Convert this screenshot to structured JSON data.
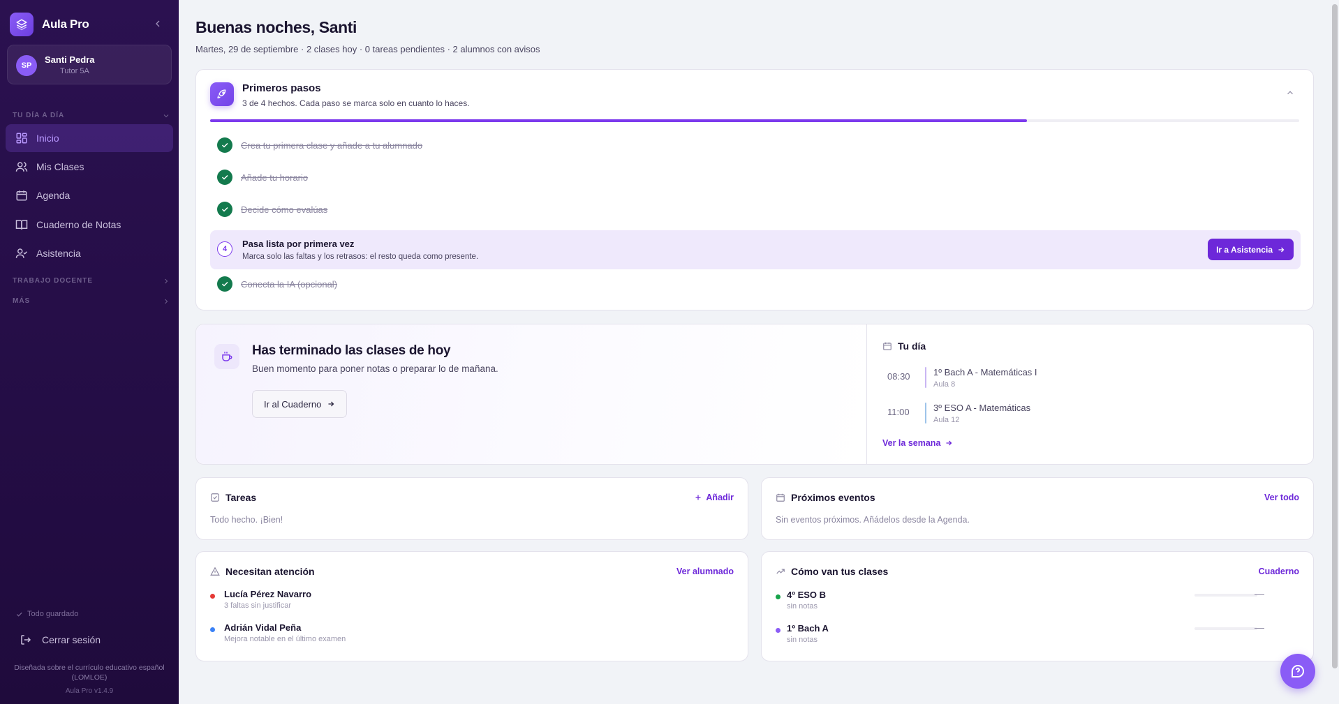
{
  "app": {
    "name": "Aula Pro",
    "version": "Aula Pro v1.4.9"
  },
  "user": {
    "initials": "SP",
    "name": "Santi Pedra",
    "role": "Tutor 5A"
  },
  "sidebar": {
    "sections": {
      "daily": "TU DÍA A DÍA",
      "work": "TRABAJO DOCENTE",
      "more": "MÁS"
    },
    "items": [
      {
        "label": "Inicio",
        "icon": "dashboard-icon",
        "active": true
      },
      {
        "label": "Mis Clases",
        "icon": "users-icon"
      },
      {
        "label": "Agenda",
        "icon": "calendar-icon"
      },
      {
        "label": "Cuaderno de Notas",
        "icon": "book-icon"
      },
      {
        "label": "Asistencia",
        "icon": "user-check-icon"
      }
    ],
    "saved": "Todo guardado",
    "logout": "Cerrar sesión",
    "footer_note": "Diseñada sobre el currículo educativo español (LOMLOE)"
  },
  "header": {
    "greeting": "Buenas noches, Santi",
    "summary": "Martes, 29 de septiembre · 2 clases hoy · 0 tareas pendientes · 2 alumnos con avisos"
  },
  "onboarding": {
    "title": "Primeros pasos",
    "subtitle": "3 de 4 hechos. Cada paso se marca solo en cuanto lo haces.",
    "progress": 0.75,
    "steps": [
      {
        "label": "Crea tu primera clase y añade a tu alumnado",
        "done": true
      },
      {
        "label": "Añade tu horario",
        "done": true
      },
      {
        "label": "Decide cómo evalúas",
        "done": true
      },
      {
        "number": "4",
        "label": "Pasa lista por primera vez",
        "description": "Marca solo las faltas y los retrasos: el resto queda como presente.",
        "done": false,
        "action": "Ir a Asistencia"
      },
      {
        "label": "Conecta la IA (opcional)",
        "done": true
      }
    ]
  },
  "today": {
    "title": "Has terminado las clases de hoy",
    "subtitle": "Buen momento para poner notas o preparar lo de mañana.",
    "action": "Ir al Cuaderno",
    "day_title": "Tu día",
    "schedule": [
      {
        "time": "08:30",
        "subject": "1º Bach A - Matemáticas I",
        "room": "Aula 8",
        "color": "#c9b6f3"
      },
      {
        "time": "11:00",
        "subject": "3º ESO A - Matemáticas",
        "room": "Aula 12",
        "color": "#9ec4ea"
      }
    ],
    "week_link": "Ver la semana"
  },
  "tasks": {
    "title": "Tareas",
    "add": "Añadir",
    "empty": "Todo hecho. ¡Bien!"
  },
  "events": {
    "title": "Próximos eventos",
    "link": "Ver todo",
    "empty": "Sin eventos próximos. Añádelos desde la Agenda."
  },
  "attention": {
    "title": "Necesitan atención",
    "link": "Ver alumnado",
    "students": [
      {
        "name": "Lucía Pérez Navarro",
        "note": "3 faltas sin justificar",
        "color": "#e53935"
      },
      {
        "name": "Adrián Vidal Peña",
        "note": "Mejora notable en el último examen",
        "color": "#3b82f6"
      }
    ]
  },
  "classes": {
    "title": "Cómo van tus clases",
    "link": "Cuaderno",
    "items": [
      {
        "name": "4º ESO B",
        "note": "sin notas",
        "value": "—",
        "color": "#16a34a"
      },
      {
        "name": "1º Bach A",
        "note": "sin notas",
        "value": "—",
        "color": "#8b5cf6"
      }
    ]
  },
  "colors": {
    "accent": "#6d28d9",
    "success": "#137a4d",
    "sidebar": "#2b1150"
  }
}
